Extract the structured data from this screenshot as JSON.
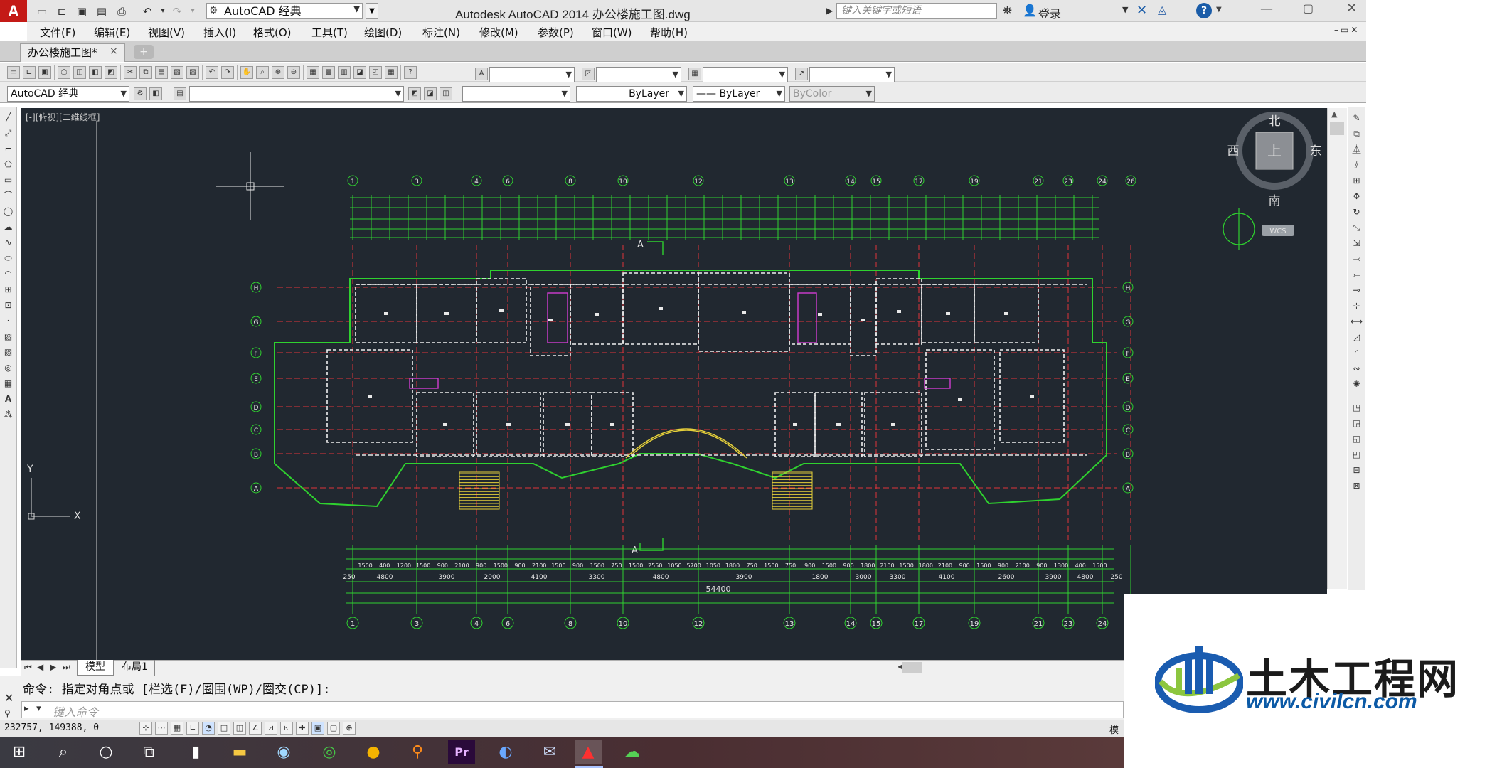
{
  "app": {
    "logo_letter": "A",
    "window_title": "Autodesk AutoCAD 2014    办公楼施工图.dwg",
    "workspace": "AutoCAD 经典",
    "search_placeholder": "键入关键字或短语",
    "login_label": "登录"
  },
  "menu": {
    "items": [
      "文件(F)",
      "编辑(E)",
      "视图(V)",
      "插入(I)",
      "格式(O)",
      "工具(T)",
      "绘图(D)",
      "标注(N)",
      "修改(M)",
      "参数(P)",
      "窗口(W)",
      "帮助(H)"
    ]
  },
  "file_tab": {
    "label": "办公楼施工图*",
    "close_glyph": "×"
  },
  "toolbar2": {
    "workspace": "AutoCAD 经典",
    "linetype": "ByLayer",
    "lineweight": "—— ByLayer",
    "color": "ByColor"
  },
  "viewport": {
    "label": "[-][俯视][二维线框]"
  },
  "viewcube": {
    "north": "北",
    "south": "南",
    "east": "东",
    "west": "西",
    "top": "上",
    "wcs": "WCS"
  },
  "ucs": {
    "x": "X",
    "y": "Y"
  },
  "drawing": {
    "axis_numbers_bottom": [
      "1",
      "3",
      "4",
      "6",
      "8",
      "10",
      "12",
      "13",
      "14",
      "15",
      "17",
      "19",
      "21",
      "23",
      "24",
      "26"
    ],
    "axis_letters_left": [
      "H",
      "G",
      "F",
      "E",
      "D",
      "C",
      "B",
      "A"
    ],
    "dims_row1": [
      "1500",
      "400",
      "1200",
      "1500",
      "900",
      "2100",
      "900",
      "1500",
      "900",
      "2100",
      "1500",
      "900",
      "1500",
      "750",
      "1500",
      "2550",
      "1050",
      "5700",
      "1050",
      "1800",
      "750",
      "1500",
      "750",
      "900",
      "1500",
      "900",
      "1800",
      "2100",
      "1500",
      "1800",
      "2100",
      "900",
      "1500",
      "900",
      "2100",
      "900",
      "1300",
      "400",
      "1500"
    ],
    "dims_row2": [
      "250",
      "4800",
      "3900",
      "2000",
      "4100",
      "3300",
      "4800",
      "3900",
      "1800",
      "3000",
      "3300",
      "4100",
      "2600",
      "3900",
      "4800",
      "250"
    ],
    "overall_dim": "54400",
    "section_mark": "A"
  },
  "layout_tabs": {
    "model": "模型",
    "layout1": "布局1"
  },
  "command": {
    "history": "命令: 指定对角点或 [栏选(F)/圈围(WP)/圈交(CP)]:",
    "input_placeholder": "键入命令"
  },
  "status": {
    "coords": "232757, 149388, 0",
    "model": "模"
  },
  "watermark": {
    "title": "土木工程网",
    "url": "www.civilcn.com"
  },
  "colors": {
    "drawing_bg": "#212830",
    "wall_green": "#2fd12f",
    "axis_red": "#e0343a",
    "text_white": "#e8e8e8",
    "brand_blue": "#0c5aa6",
    "accent_red": "#c41a16"
  }
}
